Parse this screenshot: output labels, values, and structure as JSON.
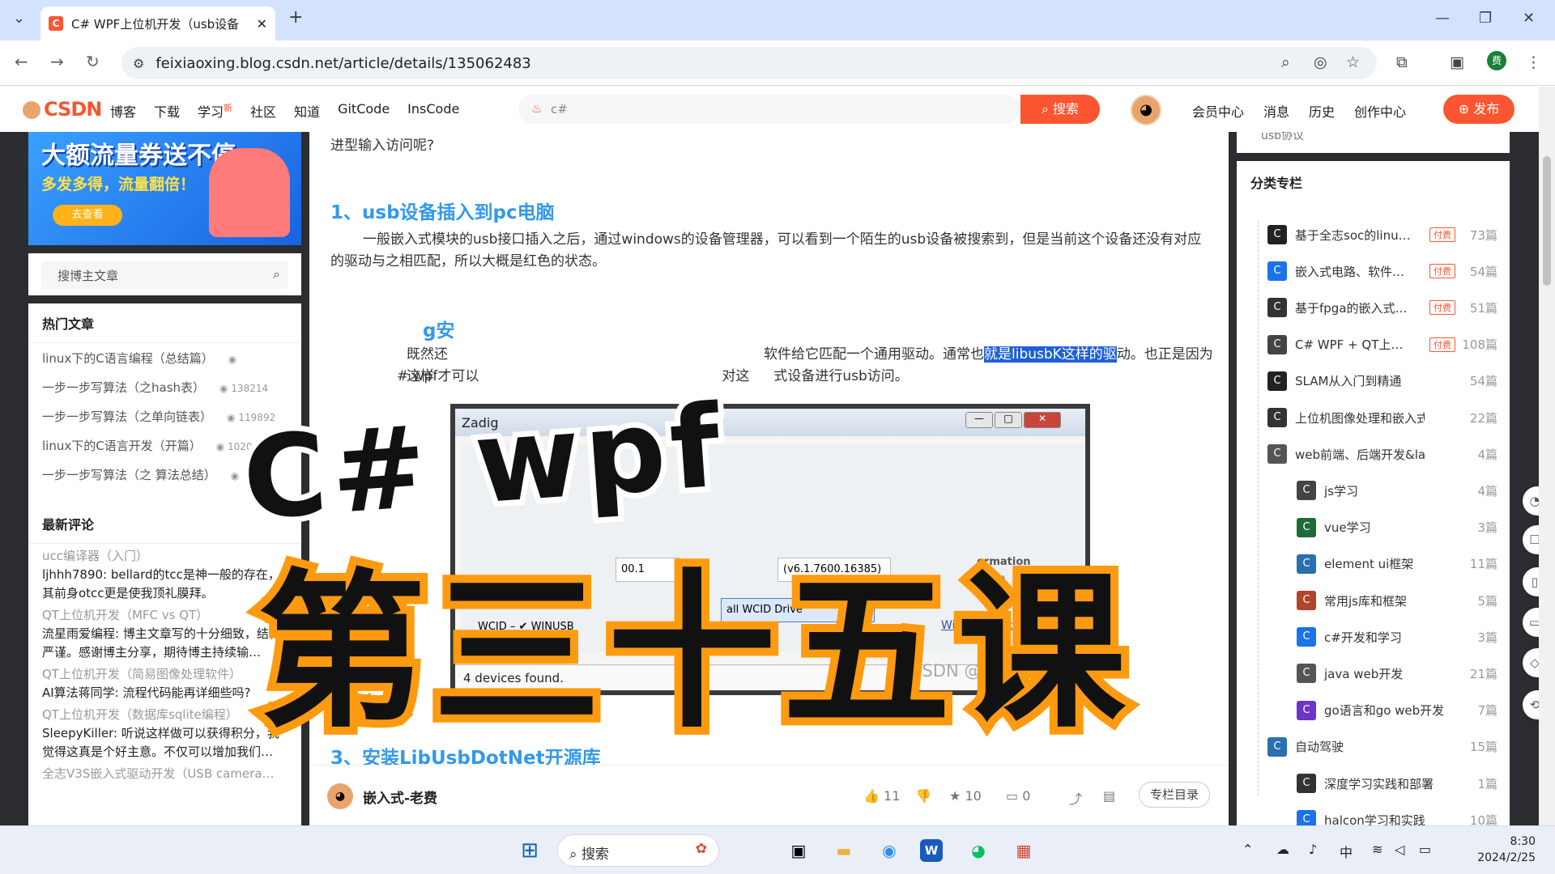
{
  "browser": {
    "tab_title": "C# WPF上位机开发（usb设备",
    "tab_favicon": "C",
    "new_tab": "+",
    "url": "feixiaoxing.blog.csdn.net/article/details/135062483",
    "profile_initial": "费"
  },
  "csdn_nav": {
    "logo": "CSDN",
    "links": [
      "博客",
      "下载",
      "学习",
      "社区",
      "知道",
      "GitCode",
      "InsCode"
    ],
    "learn_badge": "新",
    "search_placeholder": "c#",
    "search_button": "搜索",
    "right_links": [
      "会员中心",
      "消息",
      "历史",
      "创作中心"
    ],
    "publish_button": "发布"
  },
  "left": {
    "banner": {
      "line1": "大额流量券送不停",
      "line2a": "多发多得，",
      "line2b": "流量翻倍！",
      "cta": "去查看"
    },
    "search_placeholder": "搜博主文章",
    "hot_title": "热门文章",
    "hot": [
      {
        "title": "linux下的C语言编程（总结篇）",
        "views": ""
      },
      {
        "title": "一步一步写算法（之hash表）",
        "views": "138214"
      },
      {
        "title": "一步一步写算法（之单向链表）",
        "views": "119892"
      },
      {
        "title": "linux下的C语言开发（开篇）",
        "views": "10209"
      },
      {
        "title": "一步一步写算法（之 算法总结）",
        "views": ""
      }
    ],
    "comments_title": "最新评论",
    "comments": [
      {
        "post": "ucc编译器（入门）",
        "text": "ljhhh7890: bellard的tcc是神一般的存在，其前身otcc更是使我顶礼膜拜。"
      },
      {
        "post": "QT上位机开发（MFC vs QT）",
        "text": "流星雨爱编程: 博主文章写的十分细致，结构严谨。感谢博主分享，期待博主持续输…"
      },
      {
        "post": "QT上位机开发（简易图像处理软件）",
        "text": "AI算法蒋同学: 流程代码能再详细些吗?"
      },
      {
        "post": "QT上位机开发（数据库sqlite编程）",
        "text": "SleepyKiller: 听说这样做可以获得积分，我觉得这真是个好主意。不仅可以增加我们…"
      },
      {
        "post": "全志V3S嵌入式驱动开发（USB camera…",
        "text": ""
      }
    ]
  },
  "article": {
    "top_text": "进型输入访问呢?",
    "h1": "1、usb设备插入到pc电脑",
    "p1": "一般嵌入式模块的usb接口插入之后，通过windows的设备管理器，可以看到一个陌生的usb设备被搜索到，但是当前这个设备还没有对应的驱动与之相匹配，所以大概是红色的状态。",
    "h2_partial": "g安",
    "p2_a": "既然还",
    "p2_b": "软件给它匹配一个通用驱动。通常也",
    "p2_hl": "就是libusbK这样的驱",
    "p2_c": "动。也正是因为这样",
    "p2_line2_a": "# wpf才可以",
    "p2_line2_b": "对这",
    "p2_line2_c": "式设备进行usb访问。",
    "zadig": {
      "title": "Zadig",
      "status": "4 devices found.",
      "watermark": "CSDN @嵌入式-老费",
      "driver_link": "WinUSB (Microsoft)",
      "install_btn": "all WCID Drive",
      "wcid": "WCID",
      "winusb": "WINUSB",
      "info": "ormation",
      "ver": "1.0)",
      "num1": "00.1",
      "num2": "(v6.1.7600.16385)"
    },
    "h3": "3、安装LibUsbDotNet开源库",
    "author": "嵌入式-老费",
    "likes": "11",
    "stars": "10",
    "comments": "0",
    "column_btn": "专栏目录"
  },
  "overlay": {
    "line1": "C# wpf",
    "line2": "第三十五课"
  },
  "right": {
    "top_text": "usb协议",
    "title": "分类专栏",
    "paid_label": "付费",
    "columns": [
      {
        "name": "基于全志soc的linu…",
        "paid": true,
        "count": "73篇",
        "icon_color": "#222"
      },
      {
        "name": "嵌入式电路、软件…",
        "paid": true,
        "count": "54篇",
        "icon_color": "#1a73e8"
      },
      {
        "name": "基于fpga的嵌入式…",
        "paid": true,
        "count": "51篇",
        "icon_color": "#333"
      },
      {
        "name": "C# WPF + QT上…",
        "paid": true,
        "count": "108篇",
        "icon_color": "#444"
      },
      {
        "name": "SLAM从入门到精通",
        "paid": false,
        "count": "54篇",
        "icon_color": "#222"
      },
      {
        "name": "上位机图像处理和嵌入式…",
        "paid": false,
        "count": "22篇",
        "icon_color": "#333"
      },
      {
        "name": "web前端、后端开发&layui…",
        "paid": false,
        "count": "4篇",
        "icon_color": "#555"
      }
    ],
    "sub_columns": [
      {
        "name": "js学习",
        "count": "4篇",
        "icon_color": "#444"
      },
      {
        "name": "vue学习",
        "count": "3篇",
        "icon_color": "#1d6b3a"
      },
      {
        "name": "element ui框架",
        "count": "11篇",
        "icon_color": "#2a6fb0"
      },
      {
        "name": "常用js库和框架",
        "count": "5篇",
        "icon_color": "#b0452a"
      },
      {
        "name": "c#开发和学习",
        "count": "3篇",
        "icon_color": "#1a73e8"
      },
      {
        "name": "java web开发",
        "count": "21篇",
        "icon_color": "#555"
      },
      {
        "name": "go语言和go web开发",
        "count": "7篇",
        "icon_color": "#6a35c8"
      }
    ],
    "columns2": [
      {
        "name": "自动驾驶",
        "count": "15篇",
        "icon_color": "#2a6fb0"
      }
    ],
    "sub_columns2": [
      {
        "name": "深度学习实践和部署",
        "count": "1篇",
        "icon_color": "#333"
      },
      {
        "name": "halcon学习和实践",
        "count": "10篇",
        "icon_color": "#1a73e8"
      }
    ]
  },
  "taskbar": {
    "search": "搜索",
    "ime": "中",
    "time": "8:30",
    "date": "2024/2/25"
  }
}
